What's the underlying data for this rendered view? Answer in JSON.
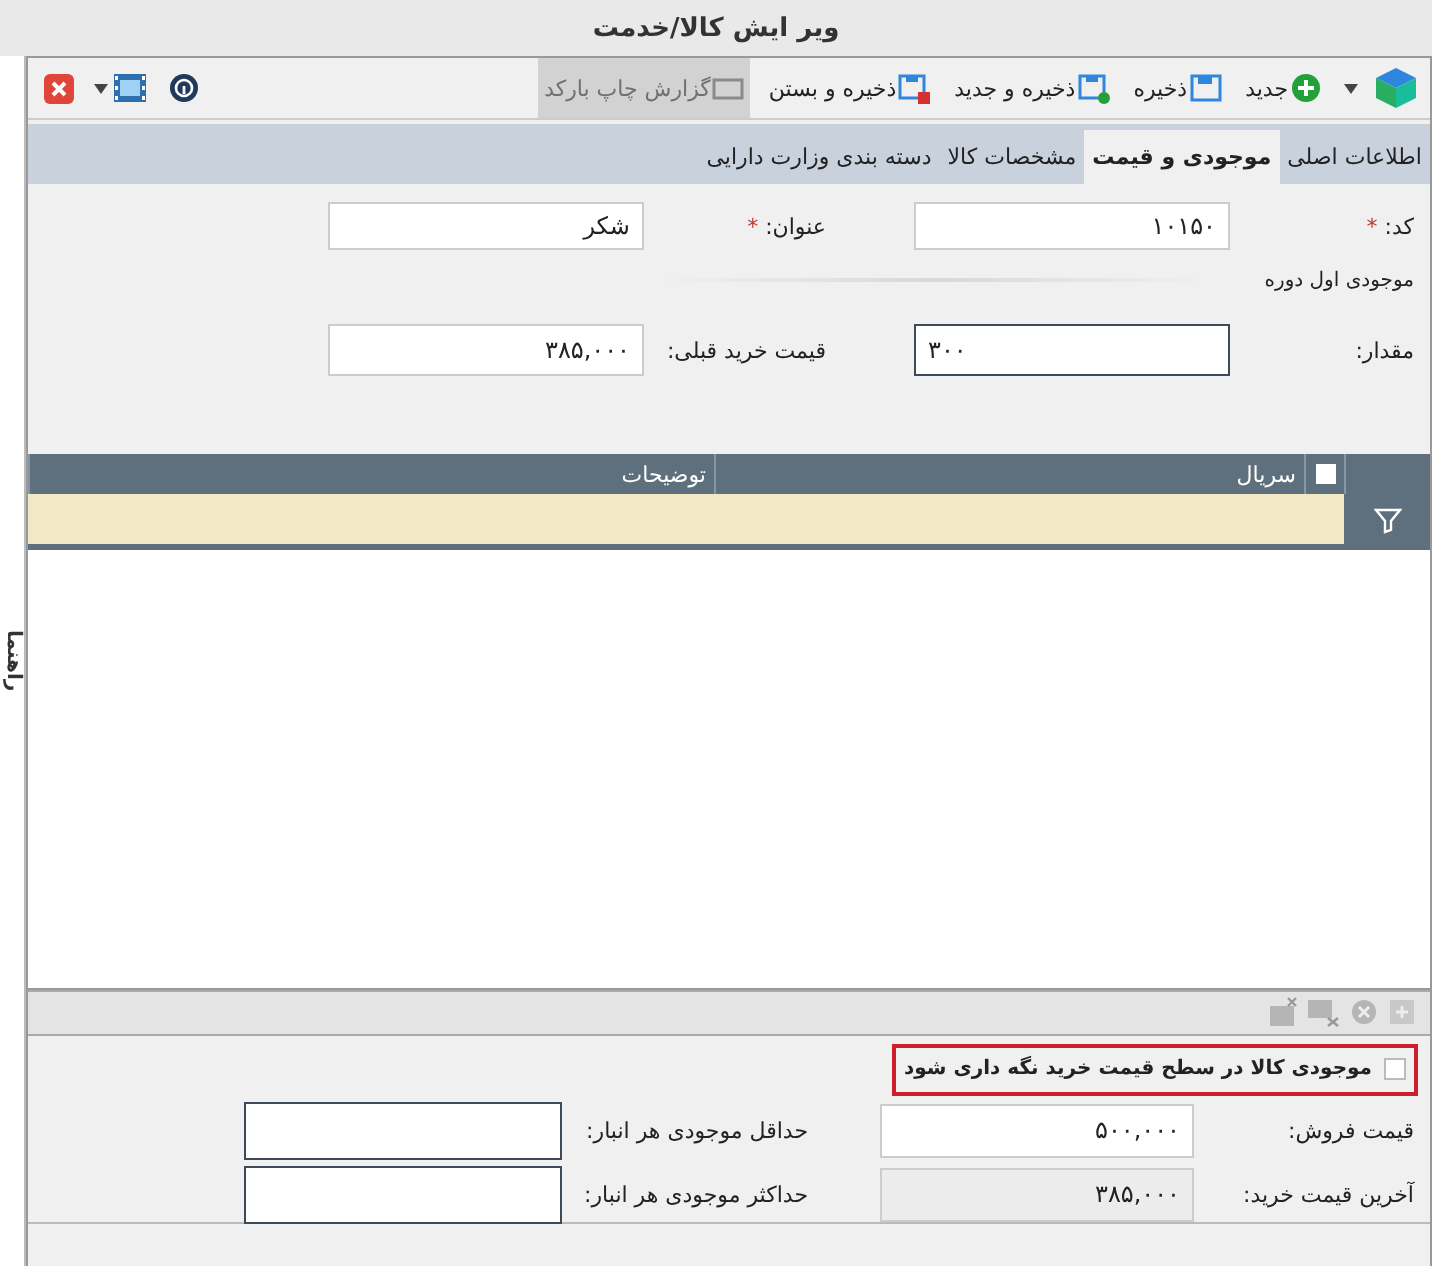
{
  "window": {
    "title": "ویر ایش کالا/خدمت"
  },
  "side_tab": {
    "label": "راهنما"
  },
  "toolbar": {
    "buttons": [
      {
        "kind": "new",
        "label": "جدید",
        "disabled": false
      },
      {
        "kind": "save",
        "label": "ذخیره",
        "disabled": false
      },
      {
        "kind": "save_new",
        "label": "ذخیره و جدید",
        "disabled": false
      },
      {
        "kind": "save_close",
        "label": "ذخیره و بستن",
        "disabled": false
      },
      {
        "kind": "barcode",
        "label": "گزارش چاپ بارکد",
        "disabled": true
      }
    ]
  },
  "tabs": [
    {
      "label": "اطلاعات اصلی",
      "selected": false
    },
    {
      "label": "موجودی و قیمت",
      "selected": true
    },
    {
      "label": "مشخصات کالا",
      "selected": false
    },
    {
      "label": "دسته بندی وزارت دارایی",
      "selected": false
    }
  ],
  "main_fields": [
    {
      "label": "کد:",
      "required_mark": "*",
      "value": "۱۰۱۵۰"
    },
    {
      "label": "عنوان:",
      "required_mark": "*",
      "value": "شکر"
    }
  ],
  "opening_stock": {
    "heading": "موجودی اول دوره",
    "fields": [
      {
        "label": "مقدار:",
        "value": "۳۰۰",
        "focused": true
      },
      {
        "label": "قیمت خرید قبلی:",
        "value": "۳۸۵,۰۰۰",
        "focused": false
      }
    ]
  },
  "serial_grid": {
    "columns": [
      "سریال",
      "توضیحات"
    ],
    "select_all_checked": false
  },
  "keep_stock_checkbox": {
    "label": "موجودی کالا در سطح قیمت خرید نگه داری شود",
    "checked": false
  },
  "price_fields": [
    {
      "label": "قیمت فروش:",
      "value": "۵۰۰,۰۰۰",
      "disabled": false
    },
    {
      "label": "آخرین قیمت خرید:",
      "value": "۳۸۵,۰۰۰",
      "disabled": true
    }
  ],
  "stock_limits": [
    {
      "label": "حداقل موجودی هر انبار:"
    },
    {
      "label": "حداکثر موجودی هر انبار:"
    }
  ]
}
